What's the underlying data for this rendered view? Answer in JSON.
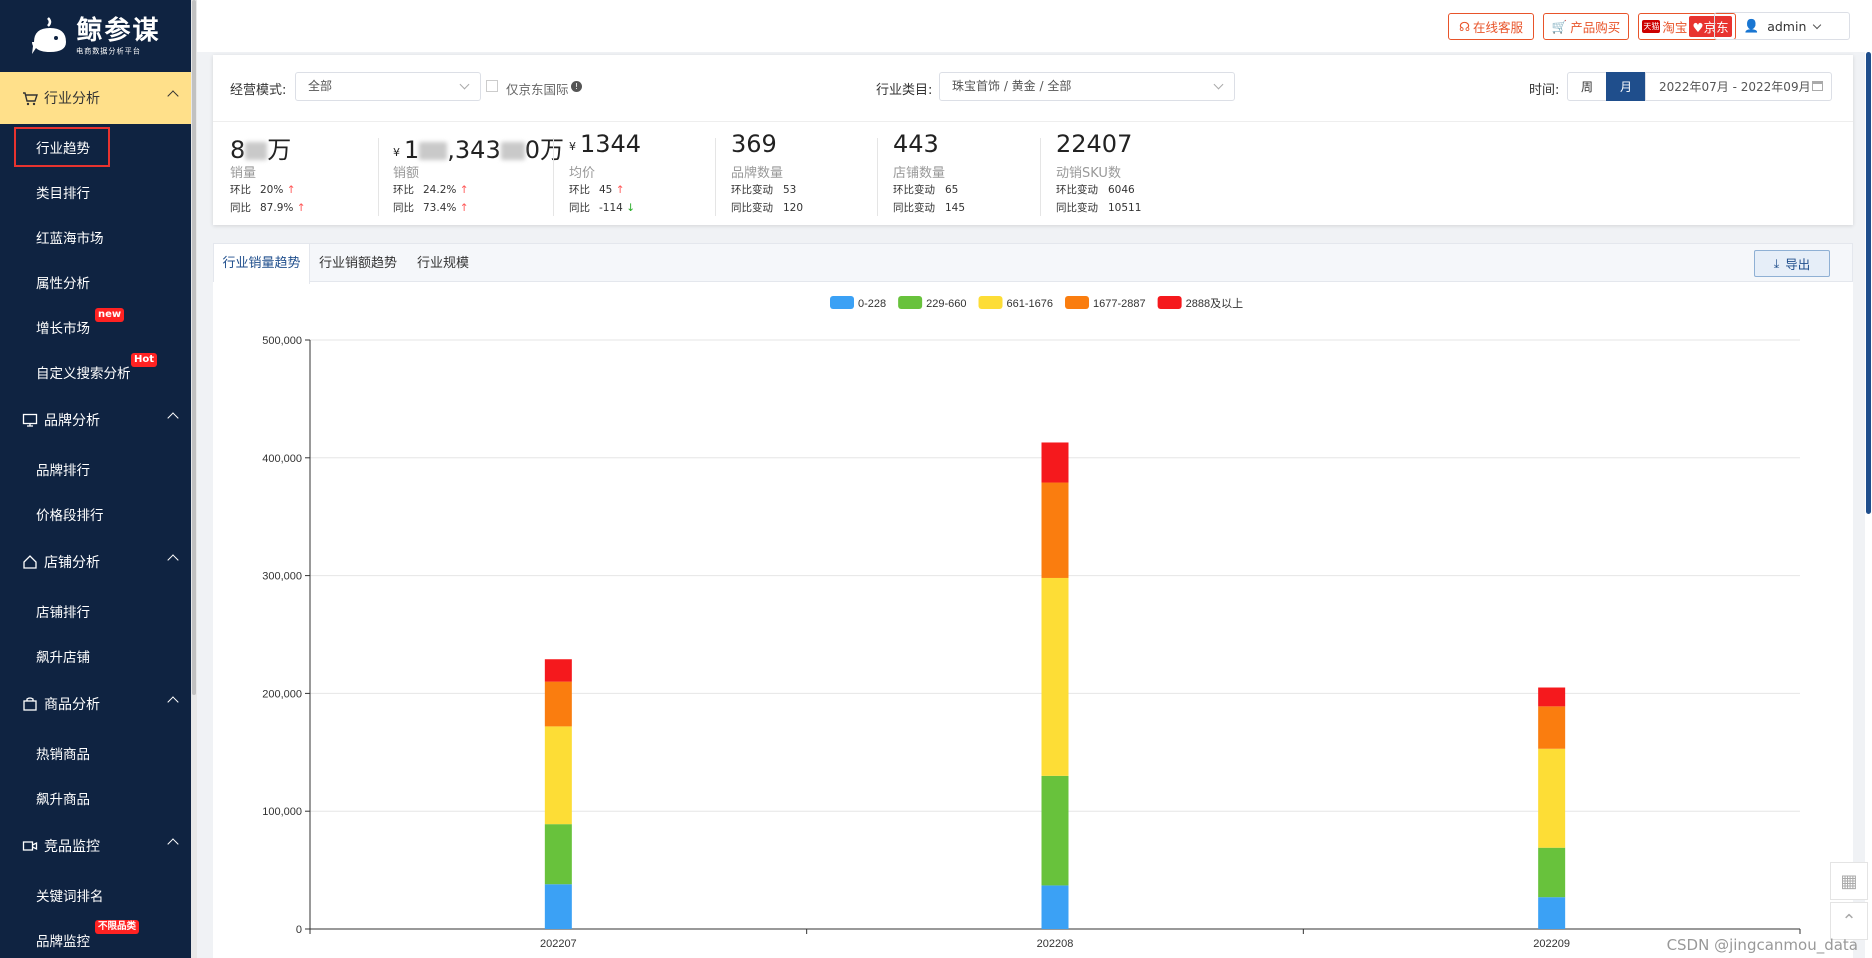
{
  "logo": {
    "title": "鲸参谋",
    "subtitle": "电商数据分析平台"
  },
  "sidebar": {
    "groups": [
      {
        "label": "行业分析",
        "items": [
          {
            "label": "行业趋势"
          },
          {
            "label": "类目排行"
          },
          {
            "label": "红蓝海市场"
          },
          {
            "label": "属性分析"
          },
          {
            "label": "增长市场",
            "badge": "new"
          },
          {
            "label": "自定义搜索分析",
            "badge": "Hot"
          }
        ]
      },
      {
        "label": "品牌分析",
        "items": [
          {
            "label": "品牌排行"
          },
          {
            "label": "价格段排行"
          }
        ]
      },
      {
        "label": "店铺分析",
        "items": [
          {
            "label": "店铺排行"
          },
          {
            "label": "飙升店铺"
          }
        ]
      },
      {
        "label": "商品分析",
        "items": [
          {
            "label": "热销商品"
          },
          {
            "label": "飙升商品"
          }
        ]
      },
      {
        "label": "竞品监控",
        "items": [
          {
            "label": "关键词排名"
          },
          {
            "label": "品牌监控",
            "badge": "不限品类"
          }
        ]
      }
    ]
  },
  "topbar": {
    "service": "在线客服",
    "purchase": "产品购买",
    "taobao": "淘宝",
    "jd": "京东",
    "tmall_tag": "天猫",
    "user": "admin"
  },
  "filters": {
    "mode_label": "经营模式:",
    "mode_value": "全部",
    "jd_intl_label": "仅京东国际",
    "category_label": "行业类目:",
    "category_value": "珠宝首饰 / 黄金 / 全部",
    "time_label": "时间:",
    "week": "周",
    "month": "月",
    "date_range": "2022年07月 - 2022年09月"
  },
  "stats": [
    {
      "value_prefix": "8",
      "value_suffix": "万",
      "name": "销量",
      "r1k": "环比",
      "r1v": "20%",
      "r1dir": "↑",
      "r2k": "同比",
      "r2v": "87.9%",
      "r2dir": "↑"
    },
    {
      "currency": "¥",
      "value_prefix": "1",
      "value_mid": ",343",
      "value_suffix": "0万",
      "name": "销额",
      "r1k": "环比",
      "r1v": "24.2%",
      "r1dir": "↑",
      "r2k": "同比",
      "r2v": "73.4%",
      "r2dir": "↑"
    },
    {
      "currency": "¥",
      "value": "1344",
      "name": "均价",
      "r1k": "环比",
      "r1v": "45",
      "r1dir": "↑",
      "r2k": "同比",
      "r2v": "-114",
      "r2dir": "↓"
    },
    {
      "value": "369",
      "name": "品牌数量",
      "r1k": "环比变动",
      "r1v": "53",
      "r2k": "同比变动",
      "r2v": "120"
    },
    {
      "value": "443",
      "name": "店铺数量",
      "r1k": "环比变动",
      "r1v": "65",
      "r2k": "同比变动",
      "r2v": "145"
    },
    {
      "value": "22407",
      "name": "动销SKU数",
      "r1k": "环比变动",
      "r1v": "6046",
      "r2k": "同比变动",
      "r2v": "10511"
    }
  ],
  "tabs": {
    "t1": "行业销量趋势",
    "t2": "行业销额趋势",
    "t3": "行业规模",
    "export": "导出"
  },
  "watermark": "CSDN @jingcanmou_data",
  "colors": {
    "sidebar_bg": "#0f2341",
    "active_group": "#ffe08a",
    "accent": "#e8542a",
    "primary": "#1f4e8c"
  },
  "chart_data": {
    "type": "bar",
    "stacked": true,
    "categories": [
      "202207",
      "202208",
      "202209"
    ],
    "series": [
      {
        "name": "0-228",
        "color": "#3ba1f5",
        "values": [
          38000,
          37000,
          27000
        ]
      },
      {
        "name": "229-660",
        "color": "#68c23c",
        "values": [
          51000,
          93000,
          42000
        ]
      },
      {
        "name": "661-1676",
        "color": "#fddd36",
        "values": [
          83000,
          168000,
          84000
        ]
      },
      {
        "name": "1677-2887",
        "color": "#fa7d0f",
        "values": [
          38000,
          81000,
          36000
        ]
      },
      {
        "name": "2888及以上",
        "color": "#f5191d",
        "values": [
          19000,
          34000,
          16000
        ]
      }
    ],
    "ylim": [
      0,
      500000
    ],
    "yticks": [
      "0",
      "100,000",
      "200,000",
      "300,000",
      "400,000",
      "500,000"
    ],
    "grid": true,
    "legend": "top-center"
  }
}
